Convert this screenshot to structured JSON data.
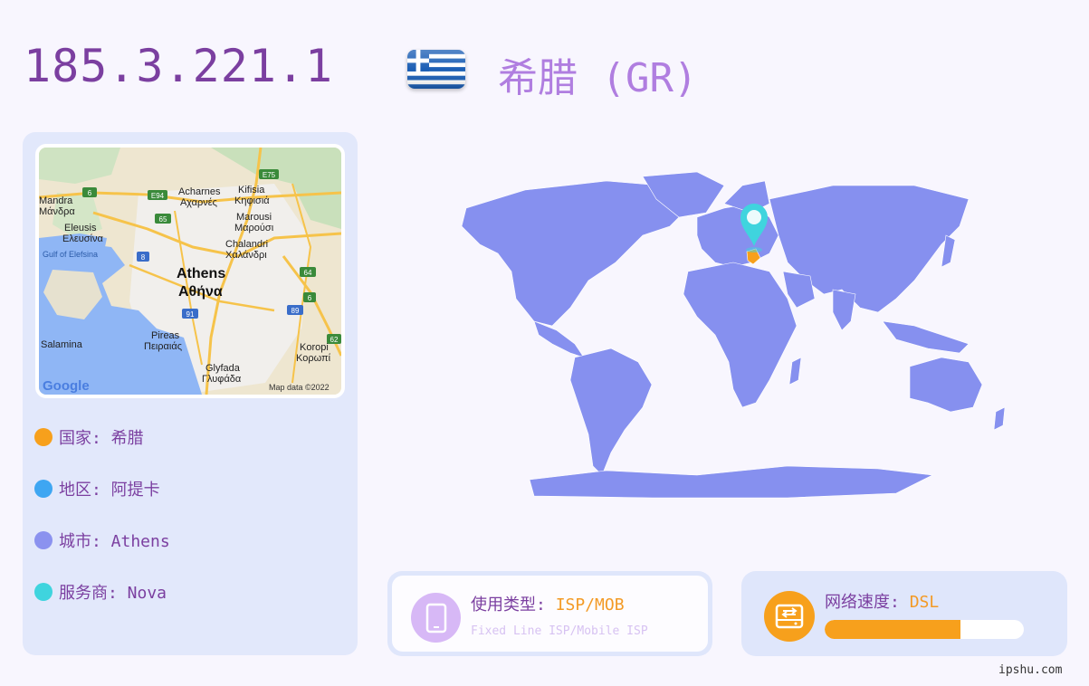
{
  "header": {
    "ip": "185.3.221.1",
    "country_title": "希腊 (GR)",
    "flag": "greece-flag"
  },
  "map": {
    "labels": [
      "Mandra",
      "Μάνδρα",
      "Acharnes",
      "Αχαρνές",
      "Kifisia",
      "Κηφισιά",
      "Marousi",
      "Μαρούσι",
      "Eleusis",
      "Ελευσίνα",
      "Chalandri",
      "Χαλάνδρι",
      "Gulf of Elefsina",
      "Athens",
      "Αθήνα",
      "Pireas",
      "Πειραιάς",
      "Salamina",
      "Koropi",
      "Κορωπί",
      "Glyfada",
      "Γλυφάδα"
    ],
    "road_badges": [
      "6",
      "E94",
      "E75",
      "65",
      "8",
      "64",
      "6",
      "91",
      "89",
      "62"
    ],
    "logo": "Google",
    "attribution": "Map data ©2022"
  },
  "info": {
    "country": "国家: 希腊",
    "region": "地区: 阿提卡",
    "city": "城市: Athens",
    "isp": "服务商: Nova"
  },
  "colors": {
    "country_dot": "#f7a01c",
    "region_dot": "#3ea6f2",
    "city_dot": "#8b92ef",
    "isp_dot": "#3fd4de",
    "land": "#8690ef",
    "accent": "#7b3fa0"
  },
  "usage": {
    "label": "使用类型: ",
    "value": "ISP/MOB",
    "sub": "Fixed Line ISP/Mobile ISP",
    "icon": "phone-icon"
  },
  "speed": {
    "label": "网络速度: ",
    "value": "DSL",
    "level": 0.68,
    "icon": "network-drive-icon"
  },
  "footer": {
    "watermark": "ipshu.com"
  }
}
